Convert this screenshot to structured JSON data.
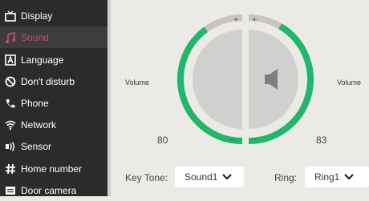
{
  "sidebar": {
    "items": [
      {
        "label": "Display",
        "icon": "tv-icon",
        "active": false
      },
      {
        "label": "Sound",
        "icon": "music-note-icon",
        "active": true
      },
      {
        "label": "Language",
        "icon": "language-icon",
        "active": false
      },
      {
        "label": "Don't disturb",
        "icon": "block-icon",
        "active": false
      },
      {
        "label": "Phone",
        "icon": "phone-icon",
        "active": false
      },
      {
        "label": "Network",
        "icon": "wifi-icon",
        "active": false
      },
      {
        "label": "Sensor",
        "icon": "sensor-icon",
        "active": false
      },
      {
        "label": "Home number",
        "icon": "hash-icon",
        "active": false
      },
      {
        "label": "Door camera",
        "icon": "camera-icon",
        "active": false
      }
    ]
  },
  "dials": {
    "left": {
      "label": "Volume",
      "value": "80",
      "plus": "+",
      "minus": "-",
      "level": 0.8
    },
    "right": {
      "label": "Volume",
      "value": "83",
      "plus": "+",
      "minus": "-",
      "level": 0.83
    }
  },
  "controls": {
    "key_tone_label": "Key Tone:",
    "key_tone_value": "Sound1",
    "ring_label": "Ring:",
    "ring_value": "Ring1"
  },
  "colors": {
    "accent_green": "#1fb86a",
    "active_text": "#c2477f",
    "track_grey": "#c9c4c4",
    "sidebar_bg": "#2b2b2b"
  }
}
